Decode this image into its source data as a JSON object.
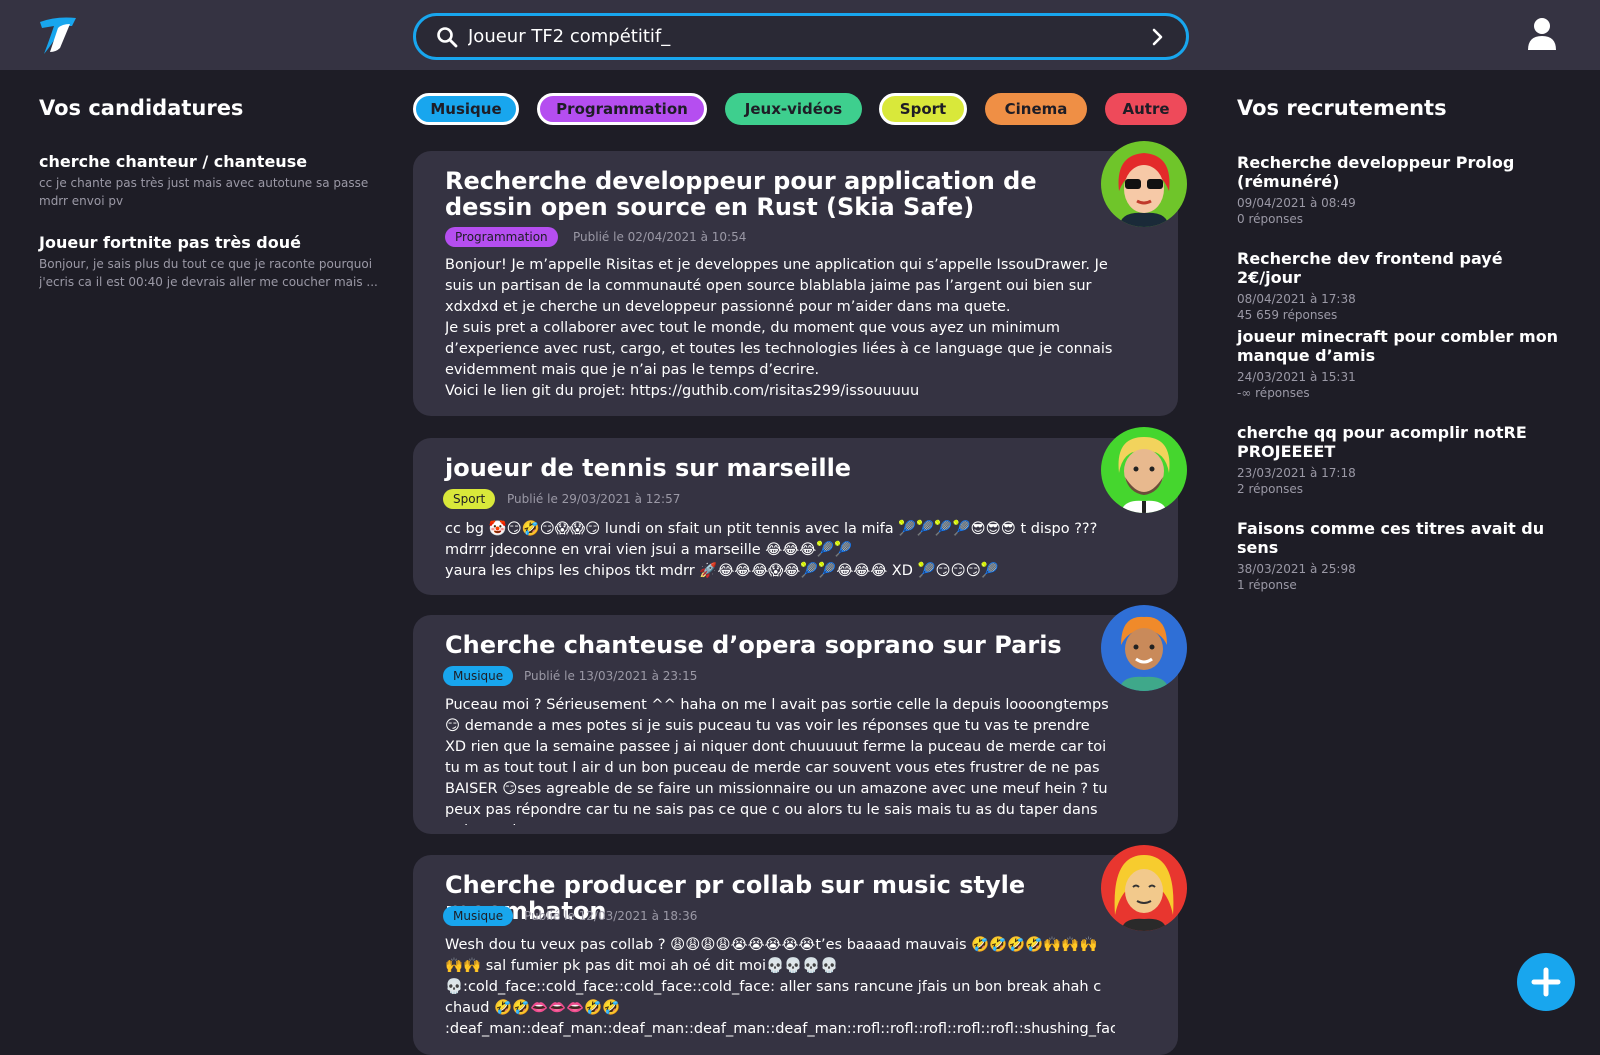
{
  "app": {
    "logo": "app-logo-icon"
  },
  "search": {
    "value": "Joueur TF2 compétitif_"
  },
  "sidebar_left": {
    "title": "Vos candidatures",
    "items": [
      {
        "title": "cherche chanteur / chanteuse",
        "desc1": "cc je chante pas très just mais avec autotune sa passe",
        "desc2": "mdrr envoi pv"
      },
      {
        "title": "Joueur fortnite pas très doué",
        "desc1": "Bonjour, je sais plus du tout ce que je raconte pourquoi",
        "desc2": "j'ecris ca il est 00:40 je devrais aller me coucher mais ..."
      }
    ]
  },
  "categories": [
    {
      "label": "Musique",
      "color": "#18a6ee",
      "selected": true
    },
    {
      "label": "Programmation",
      "color": "#b54ef0",
      "selected": true
    },
    {
      "label": "Jeux-vidéos",
      "color": "#3ecf8e",
      "selected": false
    },
    {
      "label": "Sport",
      "color": "#d9e83a",
      "selected": true
    },
    {
      "label": "Cinema",
      "color": "#ef8f45",
      "selected": false
    },
    {
      "label": "Autre",
      "color": "#ee4a5a",
      "selected": false
    }
  ],
  "posts": [
    {
      "title": "Recherche developpeur pour application de dessin open source en Rust (Skia Safe)",
      "tag": "Programmation",
      "tag_color": "#b54ef0",
      "date": "Publié le 02/04/2021 à 10:54",
      "body": "Bonjour! Je m’appelle Risitas et je developpes une application qui s’appelle IssouDrawer. Je suis un partisan de la communauté open source blablabla jaime pas l’argent oui bien sur xdxdxd et je cherche un developpeur passionné pour m’aider dans ma quete.\nJe suis pret a collaborer avec tout le monde, du moment que vous ayez un minimum d’experience avec rust, cargo, et toutes les technologies liées à ce language que je connais evidemment mais que je n’ai pas le temps d’ecrire.\nVoici le lien git du projet: https://guthib.com/risitas299/issouuuuu",
      "avatar": "avatar-red-hair-sunglasses"
    },
    {
      "title": "joueur de tennis sur marseille",
      "tag": "Sport",
      "tag_color": "#d9e83a",
      "date": "Publié le 29/03/2021 à 12:57",
      "body": "cc bg 🤡😏🤣😏😱😱😏 lundi on sfait un ptit tennis avec la mifa 🎾🎾🎾🎾😎😎😎 t dispo ???\nmdrrr jdeconne en vrai vien jsui a marseille 😂😂😂🎾🎾\nyaura les chips les chipos tkt mdrr 🚀😂😂😂😱😂🎾🎾😂😂😂 XD 🎾😏😏😏🎾",
      "avatar": "avatar-blond-beard"
    },
    {
      "title": "Cherche chanteuse d’opera soprano sur Paris",
      "tag": "Musique",
      "tag_color": "#18a6ee",
      "date": "Publié le 13/03/2021 à 23:15",
      "body": "Puceau moi ? Sérieusement ^^ haha on me l avait pas sortie celle la depuis loooongtemps 😏 demande a mes potes si je suis puceau tu vas voir les réponses que tu vas te prendre XD rien que la semaine passee j ai niquer dont chuuuuut ferme la puceau de merde car toi tu m as tout tout l air d un bon puceau de merde car souvent vous etes frustrer de ne pas BAISER 😏ses agreable de se faire un missionnaire ou un amazone avec une meuf hein ? tu peux pas répondre car tu ne sais pas ce que c ou alors tu le sais mais tu as du taper dans ta barre de ...",
      "avatar": "avatar-orange-hair-man"
    },
    {
      "title": "Cherche producer pr collab sur music style moombaton",
      "tag": "Musique",
      "tag_color": "#18a6ee",
      "date": "Publié le 12/03/2021 à 18:36",
      "body": "Wesh dou tu veux pas collab ? 😩😩😩😩😭😭😭😭😭t’es baaaad mauvais 🤣🤣🤣🤣🙌🙌🙌🙌🙌 sal fumier pk pas dit moi ah oé dit moi💀💀💀💀💀:cold_face::cold_face::cold_face::cold_face: aller sans rancune jfais un bon break ahah c chaud 🤣🤣👄👄👄🤣🤣\n:deaf_man::deaf_man::deaf_man::deaf_man::deaf_man::rofl::rofl::rofl::rofl::rofl::shushing_face::shushing_face:",
      "avatar": "avatar-blonde-woman"
    }
  ],
  "sidebar_right": {
    "title": "Vos recrutements",
    "items": [
      {
        "title": "Recherche developpeur Prolog (rémunéré)",
        "date": "09/04/2021 à 08:49",
        "replies": "0 réponses"
      },
      {
        "title": "Recherche dev frontend payé 2€/jour",
        "date": "08/04/2021 à 17:38",
        "replies": "45 659 réponses"
      },
      {
        "title": "joueur minecraft pour combler mon manque d’amis",
        "date": "24/03/2021 à 15:31",
        "replies": "-∞ réponses"
      },
      {
        "title": "cherche qq pour acomplir notRE PROJEEEET",
        "date": "23/03/2021 à 17:18",
        "replies": "2 réponses"
      },
      {
        "title": "Faisons comme ces titres avait du sens",
        "date": "38/03/2021 à 25:98",
        "replies": "1 réponse"
      }
    ]
  },
  "fab": {
    "icon": "plus-icon",
    "color": "#18a6ee"
  }
}
